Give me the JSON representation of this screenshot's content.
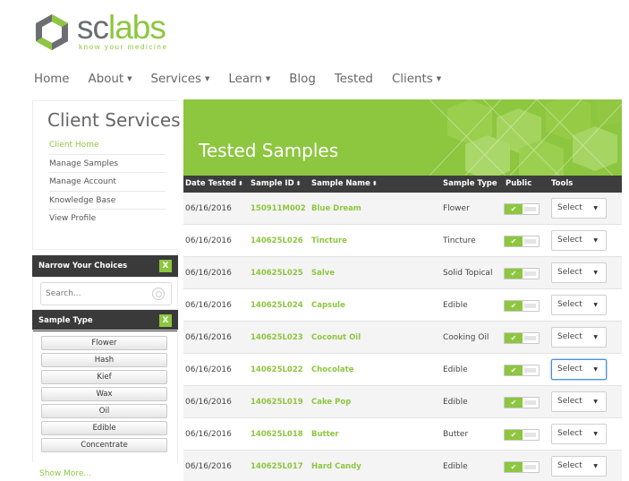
{
  "logo": {
    "text_main": "sc",
    "text_accent": "labs",
    "tagline": "know your medicine"
  },
  "nav": [
    {
      "label": "Home",
      "caret": false
    },
    {
      "label": "About",
      "caret": true
    },
    {
      "label": "Services",
      "caret": true
    },
    {
      "label": "Learn",
      "caret": true
    },
    {
      "label": "Blog",
      "caret": false
    },
    {
      "label": "Tested",
      "caret": false
    },
    {
      "label": "Clients",
      "caret": true
    }
  ],
  "sidebar": {
    "title": "Client Services",
    "menu": [
      "Client Home",
      "Manage Samples",
      "Manage Account",
      "Knowledge Base",
      "View Profile"
    ],
    "narrow_title": "Narrow Your Choices",
    "close_label": "X",
    "search_placeholder": "Search...",
    "sample_type_title": "Sample Type",
    "sample_types": [
      "Flower",
      "Hash",
      "Kief",
      "Wax",
      "Oil",
      "Edible",
      "Concentrate"
    ],
    "show_more": "Show More..."
  },
  "banner": {
    "title": "Tested Samples"
  },
  "table": {
    "headers": [
      "Date Tested",
      "Sample ID",
      "Sample Name",
      "Sample Type",
      "Public",
      "Tools"
    ],
    "sort_icon": "⬍",
    "toggle_on": "✔",
    "select_label": "Select",
    "select_arrow": "▼",
    "rows": [
      {
        "date": "06/16/2016",
        "id": "150911M002",
        "name": "Blue Dream",
        "type": "Flower"
      },
      {
        "date": "06/16/2016",
        "id": "140625L026",
        "name": "Tincture",
        "type": "Tincture"
      },
      {
        "date": "06/16/2016",
        "id": "140625L025",
        "name": "Salve",
        "type": "Solid Topical"
      },
      {
        "date": "06/16/2016",
        "id": "140625L024",
        "name": "Capsule",
        "type": "Edible"
      },
      {
        "date": "06/16/2016",
        "id": "140625L023",
        "name": "Coconut Oil",
        "type": "Cooking Oil"
      },
      {
        "date": "06/16/2016",
        "id": "140625L022",
        "name": "Chocolate",
        "type": "Edible"
      },
      {
        "date": "06/16/2016",
        "id": "140625L019",
        "name": "Cake Pop",
        "type": "Edible"
      },
      {
        "date": "06/16/2016",
        "id": "140625L018",
        "name": "Butter",
        "type": "Butter"
      },
      {
        "date": "06/16/2016",
        "id": "140625L017",
        "name": "Hard Candy",
        "type": "Edible"
      }
    ]
  },
  "colors": {
    "accent": "#8dc63f",
    "dark": "#3d3d3d"
  }
}
